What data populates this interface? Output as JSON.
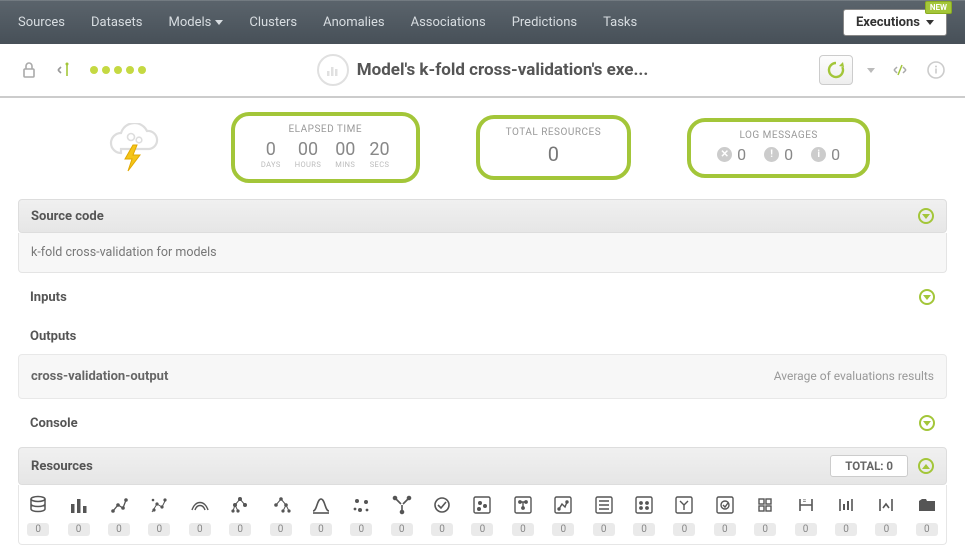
{
  "nav": {
    "sources": "Sources",
    "datasets": "Datasets",
    "models": "Models",
    "clusters": "Clusters",
    "anomalies": "Anomalies",
    "associations": "Associations",
    "predictions": "Predictions",
    "tasks": "Tasks",
    "executions": "Executions",
    "new": "NEW"
  },
  "title": "Model's k-fold cross-validation's exe...",
  "stats": {
    "elapsed": {
      "title": "ELAPSED TIME",
      "days": "0",
      "days_l": "DAYS",
      "hours": "00",
      "hours_l": "HOURS",
      "mins": "00",
      "mins_l": "MINS",
      "secs": "20",
      "secs_l": "SECS"
    },
    "resources": {
      "title": "TOTAL RESOURCES",
      "value": "0"
    },
    "logs": {
      "title": "LOG MESSAGES",
      "err": "0",
      "warn": "0",
      "info": "0"
    }
  },
  "sections": {
    "source_code": "Source code",
    "source_body": "k-fold cross-validation for models",
    "inputs": "Inputs",
    "outputs": "Outputs",
    "output_name": "cross-validation-output",
    "output_desc": "Average of evaluations results",
    "console": "Console",
    "resources": "Resources",
    "total_label": "TOTAL: 0"
  },
  "resource_items": [
    {
      "name": "source",
      "count": "0"
    },
    {
      "name": "dataset",
      "count": "0"
    },
    {
      "name": "model-a",
      "count": "0"
    },
    {
      "name": "model-b",
      "count": "0"
    },
    {
      "name": "ensemble-a",
      "count": "0"
    },
    {
      "name": "ensemble-b",
      "count": "0"
    },
    {
      "name": "ensemble-c",
      "count": "0"
    },
    {
      "name": "logistic",
      "count": "0"
    },
    {
      "name": "cluster",
      "count": "0"
    },
    {
      "name": "anomaly",
      "count": "0"
    },
    {
      "name": "association",
      "count": "0"
    },
    {
      "name": "pred-a",
      "count": "0"
    },
    {
      "name": "pred-b",
      "count": "0"
    },
    {
      "name": "pred-c",
      "count": "0"
    },
    {
      "name": "batch-a",
      "count": "0"
    },
    {
      "name": "batch-b",
      "count": "0"
    },
    {
      "name": "batch-c",
      "count": "0"
    },
    {
      "name": "batch-d",
      "count": "0"
    },
    {
      "name": "eval",
      "count": "0"
    },
    {
      "name": "script",
      "count": "0"
    },
    {
      "name": "exec-a",
      "count": "0"
    },
    {
      "name": "exec-b",
      "count": "0"
    },
    {
      "name": "folder",
      "count": "0"
    }
  ]
}
